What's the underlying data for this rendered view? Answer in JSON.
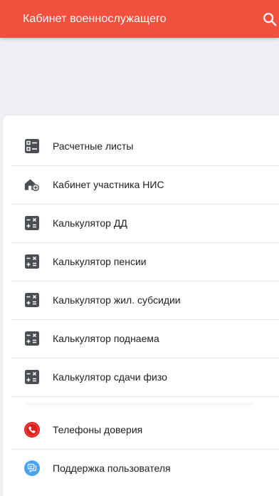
{
  "app_bar": {
    "title": "Кабинет военнослужащего",
    "background": "#f2503f",
    "search_icon": "search-icon"
  },
  "menu": [
    {
      "label": "Расчетные листы",
      "icon": "list-icon"
    },
    {
      "label": "Кабинет участника НИС",
      "icon": "house-add-icon"
    },
    {
      "label": "Калькулятор ДД",
      "icon": "calculator-icon"
    },
    {
      "label": "Калькулятор пенсии",
      "icon": "calculator-icon"
    },
    {
      "label": "Калькулятор жил. субсидии",
      "icon": "calculator-icon"
    },
    {
      "label": "Калькулятор поднаема",
      "icon": "calculator-icon"
    },
    {
      "label": "Калькулятор сдачи физо",
      "icon": "calculator-icon"
    }
  ],
  "support": [
    {
      "label": "Телефоны доверия",
      "icon": "phone-icon",
      "color": "#e02020"
    },
    {
      "label": "Поддержка пользователя",
      "icon": "chat-support-icon",
      "color": "#4aa3f0"
    }
  ]
}
